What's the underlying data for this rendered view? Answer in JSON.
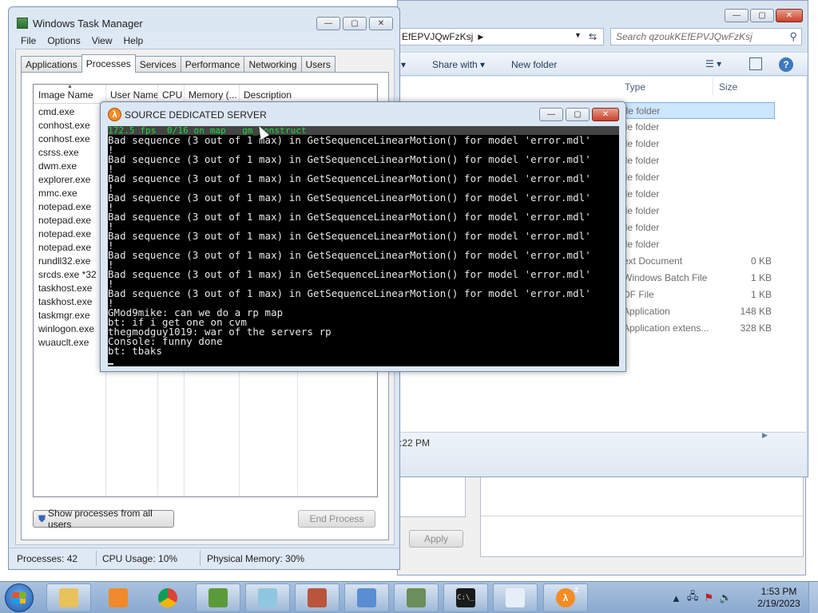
{
  "explorer": {
    "address_text": "EfEPVJQwFzKsj",
    "search_placeholder": "Search qzoukKEfEPVJQwFzKsj",
    "toolbar": {
      "share_with": "Share with",
      "new_folder": "New folder"
    },
    "columns": {
      "type": "Type",
      "size": "Size"
    },
    "files": [
      {
        "type": "ile folder",
        "size": ""
      },
      {
        "type": "ile folder",
        "size": ""
      },
      {
        "type": "ile folder",
        "size": ""
      },
      {
        "type": "ile folder",
        "size": ""
      },
      {
        "type": "ile folder",
        "size": ""
      },
      {
        "type": "ile folder",
        "size": ""
      },
      {
        "type": "ile folder",
        "size": ""
      },
      {
        "type": "ile folder",
        "size": ""
      },
      {
        "type": "ile folder",
        "size": ""
      },
      {
        "type": "ext Document",
        "size": "0 KB"
      },
      {
        "type": "Windows Batch File",
        "size": "1 KB"
      },
      {
        "type": "DF File",
        "size": "1 KB"
      },
      {
        "type": "Application",
        "size": "148 KB"
      },
      {
        "type": "Application extens...",
        "size": "328 KB"
      }
    ],
    "details_time": ":22 PM"
  },
  "properties": {
    "apply_label": "Apply"
  },
  "task_manager": {
    "title": "Windows Task Manager",
    "menu": [
      "File",
      "Options",
      "View",
      "Help"
    ],
    "tabs": [
      "Applications",
      "Processes",
      "Services",
      "Performance",
      "Networking",
      "Users"
    ],
    "active_tab": "Processes",
    "columns": [
      "Image Name",
      "User Name",
      "CPU",
      "Memory (...",
      "Description"
    ],
    "processes": [
      "cmd.exe",
      "conhost.exe",
      "conhost.exe",
      "csrss.exe",
      "dwm.exe",
      "explorer.exe",
      "mmc.exe",
      "notepad.exe",
      "notepad.exe",
      "notepad.exe",
      "notepad.exe",
      "rundll32.exe",
      "srcds.exe *32",
      "taskhost.exe",
      "taskhost.exe",
      "taskmgr.exe",
      "winlogon.exe",
      "wuauclt.exe"
    ],
    "show_all_label": "Show processes from all users",
    "end_process_label": "End Process",
    "status": {
      "processes": "Processes: 42",
      "cpu": "CPU Usage: 10%",
      "memory": "Physical Memory: 30%"
    }
  },
  "srcds": {
    "title": "SOURCE DEDICATED SERVER",
    "status_line": "172.5 fps  0/16 on map   gm_construct",
    "log": [
      "Bad sequence (3 out of 1 max) in GetSequenceLinearMotion() for model 'error.mdl'",
      "!",
      "Bad sequence (3 out of 1 max) in GetSequenceLinearMotion() for model 'error.mdl'",
      "!",
      "Bad sequence (3 out of 1 max) in GetSequenceLinearMotion() for model 'error.mdl'",
      "!",
      "Bad sequence (3 out of 1 max) in GetSequenceLinearMotion() for model 'error.mdl'",
      "!",
      "Bad sequence (3 out of 1 max) in GetSequenceLinearMotion() for model 'error.mdl'",
      "!",
      "Bad sequence (3 out of 1 max) in GetSequenceLinearMotion() for model 'error.mdl'",
      "!",
      "Bad sequence (3 out of 1 max) in GetSequenceLinearMotion() for model 'error.mdl'",
      "!",
      "Bad sequence (3 out of 1 max) in GetSequenceLinearMotion() for model 'error.mdl'",
      "!",
      "Bad sequence (3 out of 1 max) in GetSequenceLinearMotion() for model 'error.mdl'",
      "!",
      "GMod9mike: can we do a rp map",
      "bt: if i get one on cvm",
      "thegmodguy1019: war of the servers rp",
      "Console: funny done",
      "bt: tbaks"
    ]
  },
  "taskbar": {
    "items": [
      {
        "name": "windows-explorer-icon",
        "color": "#e8c25a"
      },
      {
        "name": "media-player-icon",
        "color": "#f08a2a"
      },
      {
        "name": "chrome-icon",
        "color": "#3aa757"
      },
      {
        "name": "csharp-project-icon",
        "color": "#5b9a3a"
      },
      {
        "name": "notepad-icon",
        "color": "#8fc7e0"
      },
      {
        "name": "firewall-icon",
        "color": "#b8553a"
      },
      {
        "name": "control-panel-icon",
        "color": "#5a8ed0"
      },
      {
        "name": "computer-management-icon",
        "color": "#6b8e5a"
      },
      {
        "name": "command-prompt-icon",
        "color": "#1a1a1a"
      },
      {
        "name": "document-icon",
        "color": "#e6eef8"
      },
      {
        "name": "half-life-2-icon",
        "color": "#f48c24"
      }
    ],
    "hl2_badge": "2",
    "clock_time": "1:53 PM",
    "clock_date": "2/19/2023"
  }
}
